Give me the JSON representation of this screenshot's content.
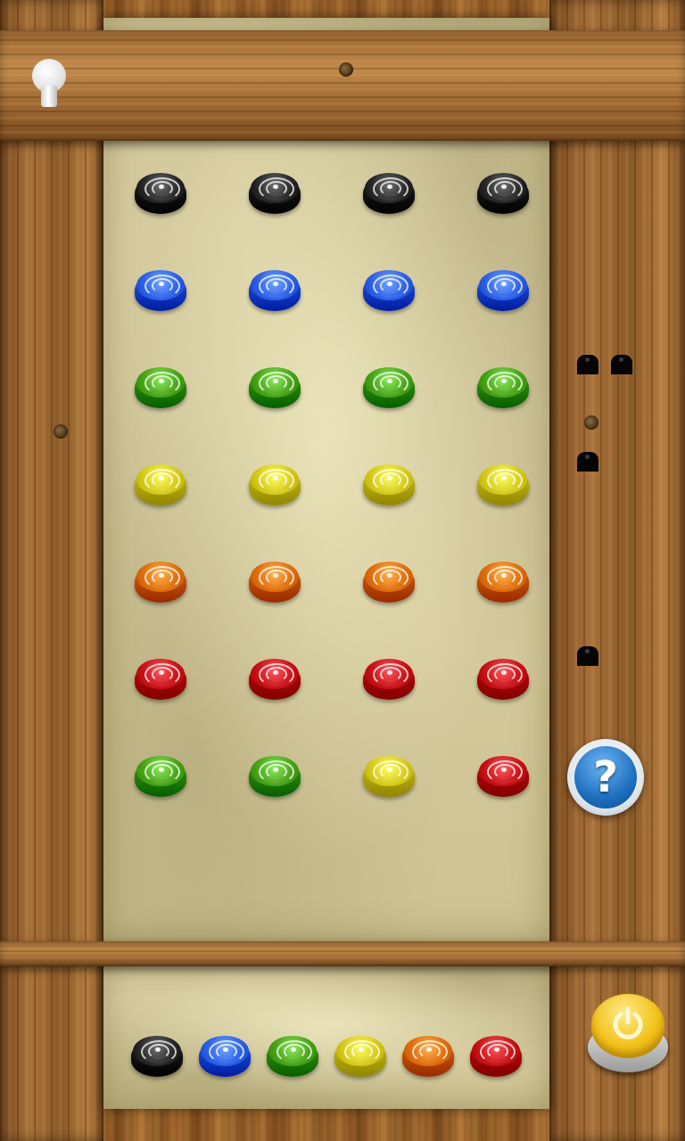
{
  "board": {
    "rows": [
      [
        "black",
        "black",
        "black",
        "black"
      ],
      [
        "blue",
        "blue",
        "blue",
        "blue"
      ],
      [
        "green",
        "green",
        "green",
        "green"
      ],
      [
        "yellow",
        "yellow",
        "yellow",
        "yellow"
      ],
      [
        "orange",
        "orange",
        "orange",
        "orange"
      ],
      [
        "red",
        "red",
        "red",
        "red"
      ],
      [
        "green",
        "green",
        "yellow",
        "red"
      ]
    ]
  },
  "feedback": [
    {
      "row": 2,
      "black_pins": 2
    },
    {
      "row": 3,
      "black_pins": 1
    },
    {
      "row": 5,
      "black_pins": 1
    }
  ],
  "palette": [
    "black",
    "blue",
    "green",
    "yellow",
    "orange",
    "red"
  ],
  "colors": {
    "black": "#2a2a2a",
    "blue": "#2f62e8",
    "green": "#4aa51a",
    "yellow": "#d7cc1e",
    "orange": "#e0700e",
    "red": "#c8141a"
  },
  "buttons": {
    "help_label": "?",
    "hint_icon": "lightbulb-icon",
    "power_icon": "power-icon"
  }
}
